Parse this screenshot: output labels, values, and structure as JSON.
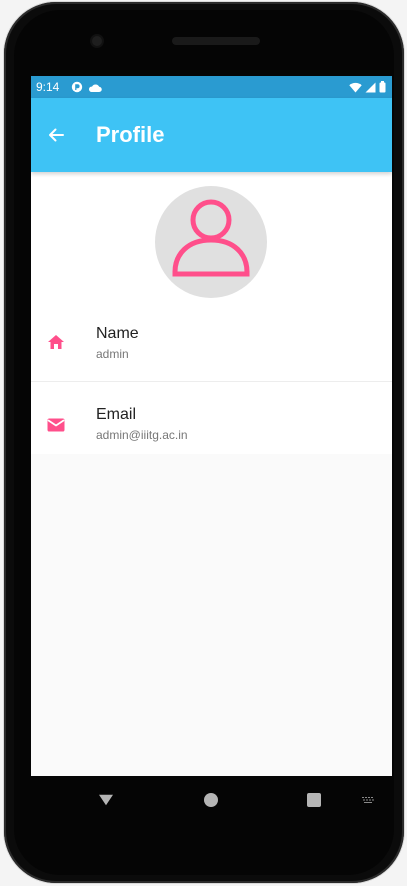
{
  "status_bar": {
    "time": "9:14",
    "left_icons": [
      "notification-app-icon",
      "cloud-icon"
    ],
    "right_icons": [
      "wifi-icon",
      "cellular-signal-icon",
      "battery-icon"
    ]
  },
  "app_bar": {
    "title": "Profile",
    "back_icon": "arrow-back-icon"
  },
  "profile": {
    "avatar_icon": "person-outline-icon",
    "items": [
      {
        "title": "Name",
        "value": "admin",
        "icon": "home-icon"
      },
      {
        "title": "Email",
        "value": "admin@iiitg.ac.in",
        "icon": "mail-icon"
      }
    ]
  },
  "nav_bar": {
    "buttons": [
      "back-triangle-icon",
      "home-circle-icon",
      "recents-square-icon",
      "keyboard-icon"
    ]
  },
  "colors": {
    "status_bar": "#2a9bd1",
    "app_bar": "#3ec3f5",
    "accent": "#ff4f8b",
    "avatar_bg": "#e0e0e0",
    "screen_bg": "#fafafa"
  }
}
